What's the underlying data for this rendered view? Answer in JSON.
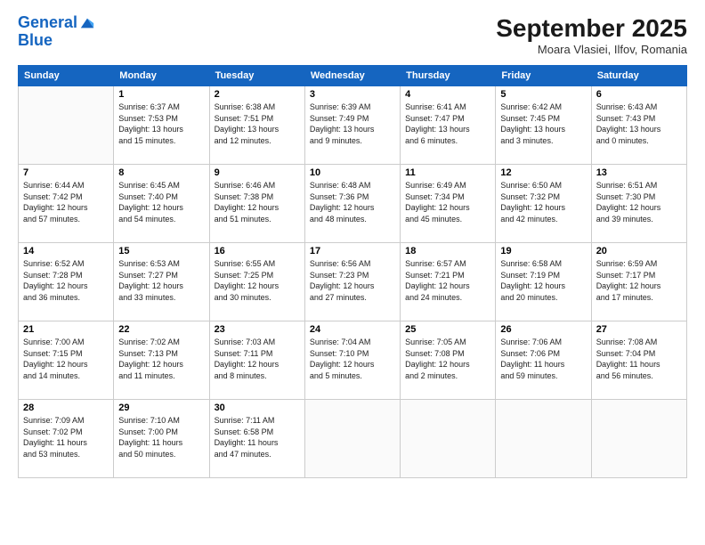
{
  "logo": {
    "line1": "General",
    "line2": "Blue"
  },
  "title": "September 2025",
  "subtitle": "Moara Vlasiei, Ilfov, Romania",
  "days_of_week": [
    "Sunday",
    "Monday",
    "Tuesday",
    "Wednesday",
    "Thursday",
    "Friday",
    "Saturday"
  ],
  "weeks": [
    [
      {
        "day": "",
        "info": ""
      },
      {
        "day": "1",
        "info": "Sunrise: 6:37 AM\nSunset: 7:53 PM\nDaylight: 13 hours\nand 15 minutes."
      },
      {
        "day": "2",
        "info": "Sunrise: 6:38 AM\nSunset: 7:51 PM\nDaylight: 13 hours\nand 12 minutes."
      },
      {
        "day": "3",
        "info": "Sunrise: 6:39 AM\nSunset: 7:49 PM\nDaylight: 13 hours\nand 9 minutes."
      },
      {
        "day": "4",
        "info": "Sunrise: 6:41 AM\nSunset: 7:47 PM\nDaylight: 13 hours\nand 6 minutes."
      },
      {
        "day": "5",
        "info": "Sunrise: 6:42 AM\nSunset: 7:45 PM\nDaylight: 13 hours\nand 3 minutes."
      },
      {
        "day": "6",
        "info": "Sunrise: 6:43 AM\nSunset: 7:43 PM\nDaylight: 13 hours\nand 0 minutes."
      }
    ],
    [
      {
        "day": "7",
        "info": "Sunrise: 6:44 AM\nSunset: 7:42 PM\nDaylight: 12 hours\nand 57 minutes."
      },
      {
        "day": "8",
        "info": "Sunrise: 6:45 AM\nSunset: 7:40 PM\nDaylight: 12 hours\nand 54 minutes."
      },
      {
        "day": "9",
        "info": "Sunrise: 6:46 AM\nSunset: 7:38 PM\nDaylight: 12 hours\nand 51 minutes."
      },
      {
        "day": "10",
        "info": "Sunrise: 6:48 AM\nSunset: 7:36 PM\nDaylight: 12 hours\nand 48 minutes."
      },
      {
        "day": "11",
        "info": "Sunrise: 6:49 AM\nSunset: 7:34 PM\nDaylight: 12 hours\nand 45 minutes."
      },
      {
        "day": "12",
        "info": "Sunrise: 6:50 AM\nSunset: 7:32 PM\nDaylight: 12 hours\nand 42 minutes."
      },
      {
        "day": "13",
        "info": "Sunrise: 6:51 AM\nSunset: 7:30 PM\nDaylight: 12 hours\nand 39 minutes."
      }
    ],
    [
      {
        "day": "14",
        "info": "Sunrise: 6:52 AM\nSunset: 7:28 PM\nDaylight: 12 hours\nand 36 minutes."
      },
      {
        "day": "15",
        "info": "Sunrise: 6:53 AM\nSunset: 7:27 PM\nDaylight: 12 hours\nand 33 minutes."
      },
      {
        "day": "16",
        "info": "Sunrise: 6:55 AM\nSunset: 7:25 PM\nDaylight: 12 hours\nand 30 minutes."
      },
      {
        "day": "17",
        "info": "Sunrise: 6:56 AM\nSunset: 7:23 PM\nDaylight: 12 hours\nand 27 minutes."
      },
      {
        "day": "18",
        "info": "Sunrise: 6:57 AM\nSunset: 7:21 PM\nDaylight: 12 hours\nand 24 minutes."
      },
      {
        "day": "19",
        "info": "Sunrise: 6:58 AM\nSunset: 7:19 PM\nDaylight: 12 hours\nand 20 minutes."
      },
      {
        "day": "20",
        "info": "Sunrise: 6:59 AM\nSunset: 7:17 PM\nDaylight: 12 hours\nand 17 minutes."
      }
    ],
    [
      {
        "day": "21",
        "info": "Sunrise: 7:00 AM\nSunset: 7:15 PM\nDaylight: 12 hours\nand 14 minutes."
      },
      {
        "day": "22",
        "info": "Sunrise: 7:02 AM\nSunset: 7:13 PM\nDaylight: 12 hours\nand 11 minutes."
      },
      {
        "day": "23",
        "info": "Sunrise: 7:03 AM\nSunset: 7:11 PM\nDaylight: 12 hours\nand 8 minutes."
      },
      {
        "day": "24",
        "info": "Sunrise: 7:04 AM\nSunset: 7:10 PM\nDaylight: 12 hours\nand 5 minutes."
      },
      {
        "day": "25",
        "info": "Sunrise: 7:05 AM\nSunset: 7:08 PM\nDaylight: 12 hours\nand 2 minutes."
      },
      {
        "day": "26",
        "info": "Sunrise: 7:06 AM\nSunset: 7:06 PM\nDaylight: 11 hours\nand 59 minutes."
      },
      {
        "day": "27",
        "info": "Sunrise: 7:08 AM\nSunset: 7:04 PM\nDaylight: 11 hours\nand 56 minutes."
      }
    ],
    [
      {
        "day": "28",
        "info": "Sunrise: 7:09 AM\nSunset: 7:02 PM\nDaylight: 11 hours\nand 53 minutes."
      },
      {
        "day": "29",
        "info": "Sunrise: 7:10 AM\nSunset: 7:00 PM\nDaylight: 11 hours\nand 50 minutes."
      },
      {
        "day": "30",
        "info": "Sunrise: 7:11 AM\nSunset: 6:58 PM\nDaylight: 11 hours\nand 47 minutes."
      },
      {
        "day": "",
        "info": ""
      },
      {
        "day": "",
        "info": ""
      },
      {
        "day": "",
        "info": ""
      },
      {
        "day": "",
        "info": ""
      }
    ]
  ]
}
